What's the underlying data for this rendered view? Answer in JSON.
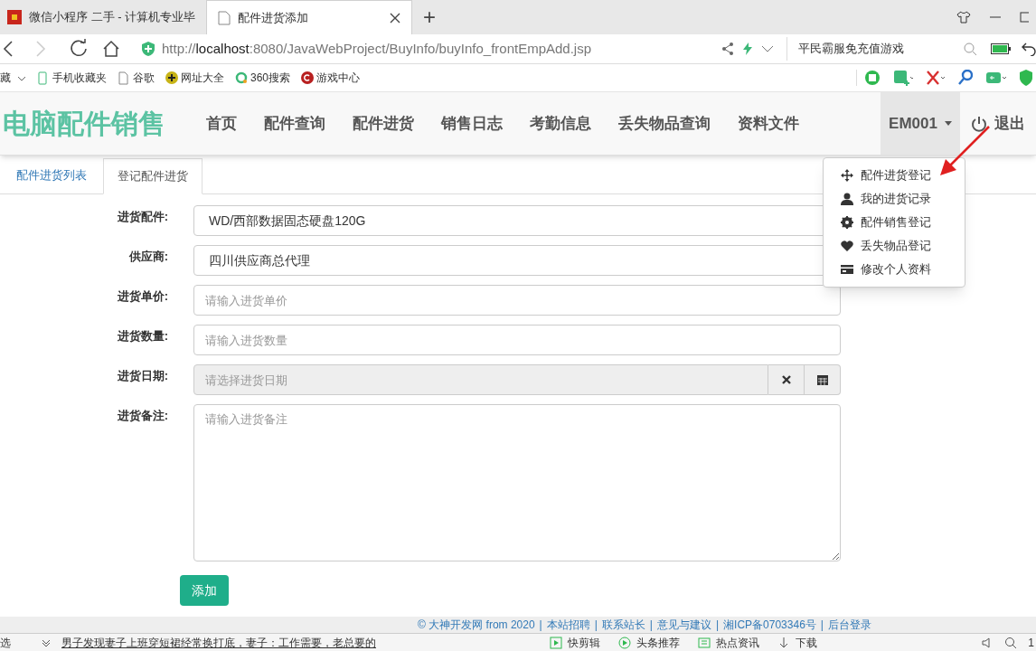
{
  "browser": {
    "tabs": [
      {
        "title": "微信小程序 二手 - 计算机专业毕",
        "selected": false
      },
      {
        "title": "配件进货添加",
        "selected": true
      }
    ],
    "new_tab": "+",
    "address": {
      "prefix": "http://",
      "host": "localhost",
      "rest": ":8080/JavaWebProject/BuyInfo/buyInfo_frontEmpAdd.jsp"
    },
    "search_text": "平民霸服免充值游戏",
    "bookmarks": [
      {
        "label": "藏",
        "kind": "folder"
      },
      {
        "label": "手机收藏夹",
        "kind": "phone"
      },
      {
        "label": "谷歌",
        "kind": "page"
      },
      {
        "label": "网址大全",
        "kind": "plus"
      },
      {
        "label": "360搜索",
        "kind": "ring"
      },
      {
        "label": "游戏中心",
        "kind": "game"
      }
    ]
  },
  "navbar": {
    "brand": "电脑配件销售",
    "items": [
      {
        "label": "首页"
      },
      {
        "label": "配件查询"
      },
      {
        "label": "配件进货"
      },
      {
        "label": "销售日志"
      },
      {
        "label": "考勤信息"
      },
      {
        "label": "丢失物品查询"
      },
      {
        "label": "资料文件"
      }
    ],
    "user": {
      "label": "EM001",
      "expanded": true
    },
    "logout": "退出"
  },
  "user_menu": [
    {
      "label": "配件进货登记",
      "kind": "move"
    },
    {
      "label": "我的进货记录",
      "kind": "user"
    },
    {
      "label": "配件销售登记",
      "kind": "gear"
    },
    {
      "label": "丢失物品登记",
      "kind": "heart"
    },
    {
      "label": "修改个人资料",
      "kind": "card"
    }
  ],
  "subtabs": [
    {
      "label": "配件进货列表",
      "selected": false
    },
    {
      "label": "登记配件进货",
      "selected": true
    }
  ],
  "form": {
    "fields": [
      {
        "label": "进货配件:",
        "kind": "select",
        "value": "WD/西部数据固态硬盘120G"
      },
      {
        "label": "供应商:",
        "kind": "select",
        "value": "四川供应商总代理"
      },
      {
        "label": "进货单价:",
        "kind": "text",
        "placeholder": "请输入进货单价"
      },
      {
        "label": "进货数量:",
        "kind": "text",
        "placeholder": "请输入进货数量"
      },
      {
        "label": "进货日期:",
        "kind": "date",
        "placeholder": "请选择进货日期"
      },
      {
        "label": "进货备注:",
        "kind": "textarea",
        "placeholder": "请输入进货备注"
      }
    ],
    "submit": "添加"
  },
  "footer": {
    "separator": "|",
    "links": [
      "© 大神开发网 from 2020",
      "本站招聘",
      "联系站长",
      "意见与建议",
      "湘ICP备0703346号",
      "后台登录"
    ]
  },
  "status_bar": {
    "left": "选",
    "news": "男子发现妻子上班穿短裙经常换打底，妻子：工作需要，老总要的",
    "items": [
      {
        "label": "快剪辑",
        "kind": "play"
      },
      {
        "label": "头条推荐",
        "kind": "circle"
      },
      {
        "label": "热点资讯",
        "kind": "news"
      },
      {
        "label": "下载",
        "kind": "download"
      }
    ],
    "zoom": "1"
  }
}
